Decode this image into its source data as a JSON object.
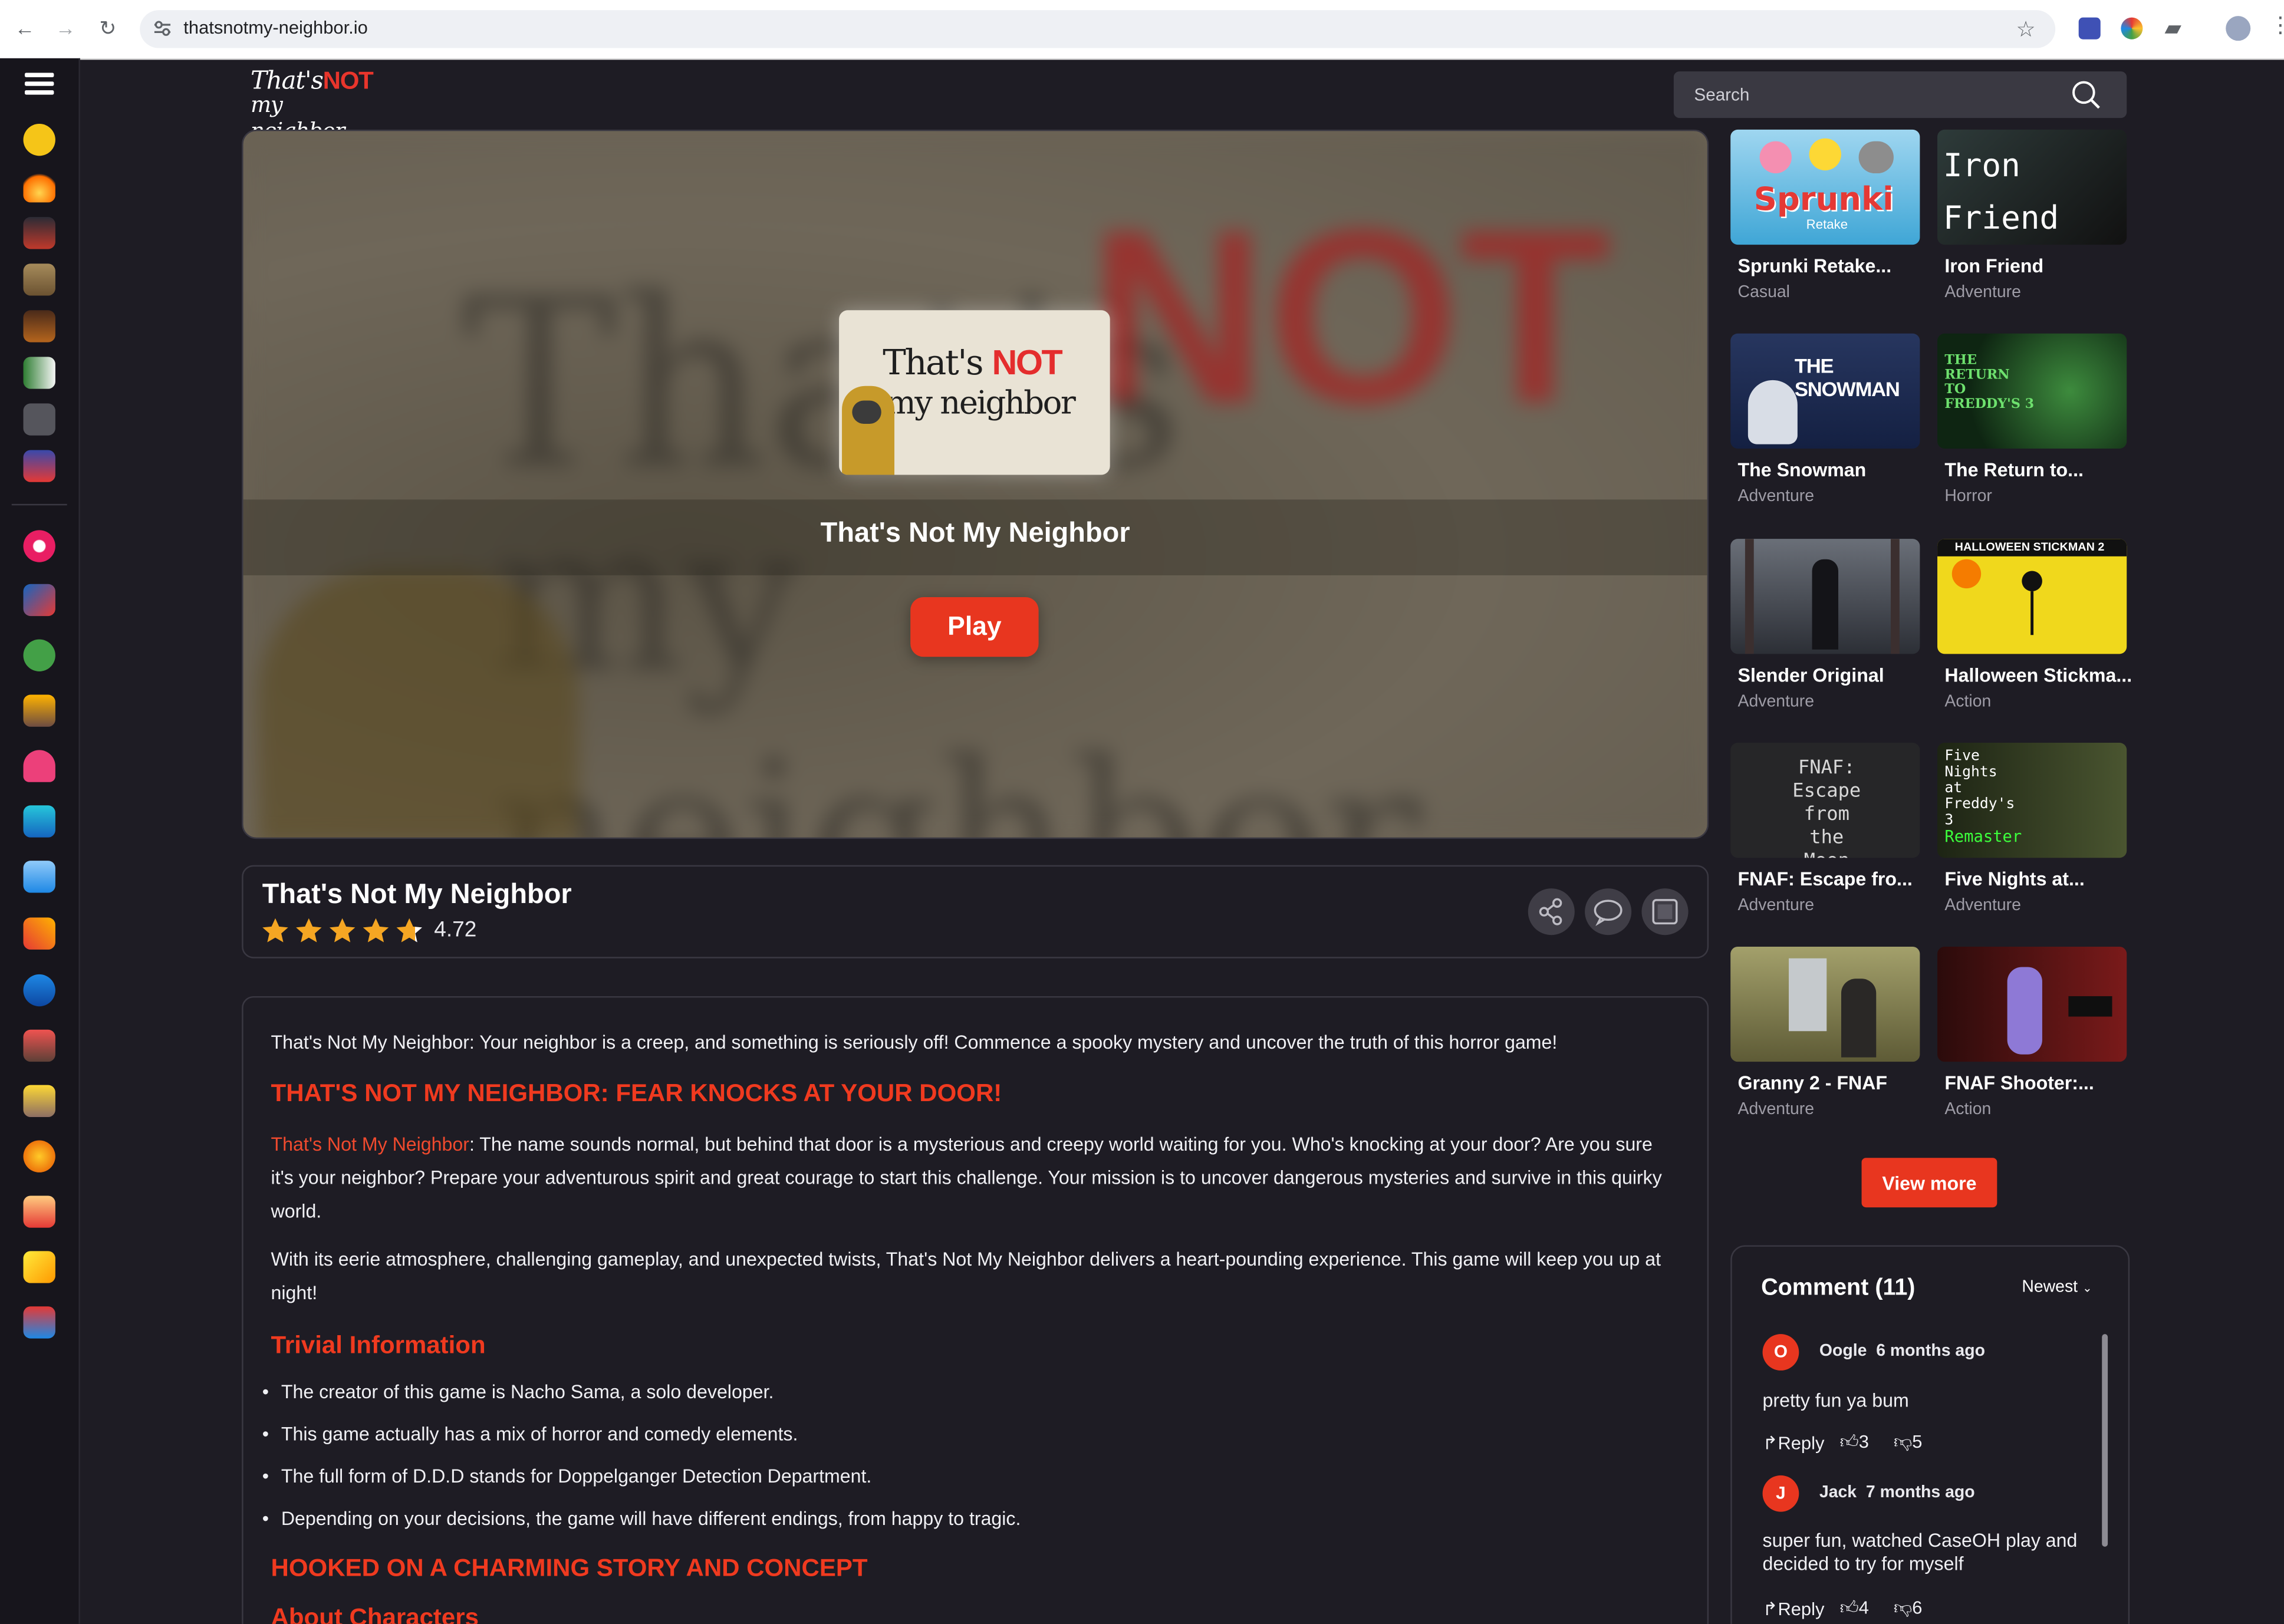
{
  "browser": {
    "url": "thatsnotmy-neighbor.io"
  },
  "site": {
    "logo_line1_a": "That's",
    "logo_line1_b": "NOT",
    "logo_line2": "my neighbor",
    "search_placeholder": "Search"
  },
  "hero": {
    "thumb_line1_a": "That's",
    "thumb_line1_b": "NOT",
    "thumb_line2": "my neighbor",
    "title": "That's Not My Neighbor",
    "play_label": "Play"
  },
  "game": {
    "title": "That's Not My Neighbor",
    "rating": "4.72",
    "stars": 4.72
  },
  "description": {
    "intro": "That's Not My Neighbor: Your neighbor is a creep, and something is seriously off! Commence a spooky mystery and uncover the truth of this horror game!",
    "h1": "THAT'S NOT MY NEIGHBOR: FEAR KNOCKS AT YOUR DOOR!",
    "p1_link": "That's Not My Neighbor",
    "p1_rest": ": The name sounds normal, but behind that door is a mysterious and creepy world waiting for you. Who's knocking at your door? Are you sure it's your neighbor? Prepare your adventurous spirit and great courage to start this challenge. Your mission is to uncover dangerous mysteries and survive in this quirky world.",
    "p2": "With its eerie atmosphere, challenging gameplay, and unexpected twists, That's Not My Neighbor delivers a heart-pounding experience. This game will keep you up at night!",
    "h2": "Trivial Information",
    "bullets": [
      "The creator of this game is Nacho Sama, a solo developer.",
      "This game actually has a mix of horror and comedy elements.",
      "The full form of D.D.D stands for Doppelganger Detection Department.",
      "Depending on your decisions, the game will have different endings, from happy to tragic."
    ],
    "h3": "HOOKED ON A CHARMING STORY AND CONCEPT",
    "h4": "About Characters"
  },
  "related": [
    {
      "name": "Sprunki Retake...",
      "category": "Casual",
      "thumb": "Sprunki",
      "thumb_sub": "Retake",
      "bg": "#3fa6d6"
    },
    {
      "name": "Iron Friend",
      "category": "Adventure",
      "thumb": "Iron Friend",
      "bg": "#1f2a2a"
    },
    {
      "name": "The Snowman",
      "category": "Adventure",
      "thumb": "THE SNOWMAN",
      "bg": "#1e2f57"
    },
    {
      "name": "The Return to...",
      "category": "Horror",
      "thumb": "THE RETURN TO FREDDY'S 3",
      "bg": "#163a1c"
    },
    {
      "name": "Slender Original",
      "category": "Adventure",
      "thumb": "",
      "bg": "#3a4048"
    },
    {
      "name": "Halloween Stickma...",
      "category": "Action",
      "thumb": "HALLOWEEN STICKMAN 2",
      "bg": "#f0d81c"
    },
    {
      "name": "FNAF: Escape fro...",
      "category": "Adventure",
      "thumb": "FNAF: Escape from the Moon",
      "bg": "#2a2a2c"
    },
    {
      "name": "Five Nights at...",
      "category": "Adventure",
      "thumb": "Five Nights at Freddy's 3",
      "thumb_sub": "Remaster",
      "bg": "#2d3420"
    },
    {
      "name": "Granny 2 - FNAF",
      "category": "Adventure",
      "thumb": "",
      "bg": "#8e8a58"
    },
    {
      "name": "FNAF Shooter:...",
      "category": "Action",
      "thumb": "",
      "bg": "#4a1212"
    }
  ],
  "view_more_label": "View more",
  "comments": {
    "title": "Comment (11)",
    "sort_label": "Newest",
    "items": [
      {
        "initial": "O",
        "author": "Oogle",
        "time": "6 months ago",
        "text": "pretty fun ya bum",
        "reply": "Reply",
        "likes": "3",
        "dislikes": "5"
      },
      {
        "initial": "J",
        "author": "Jack",
        "time": "7 months ago",
        "text": "super fun, watched CaseOH play and decided to try for myself",
        "reply": "Reply",
        "likes": "4",
        "dislikes": "6"
      }
    ]
  },
  "colors": {
    "accent": "#e8361f",
    "background": "#1e1c24",
    "rail": "#17151c"
  },
  "rail_icons": [
    "new-badge-icon",
    "fire-icon",
    "game-1-icon",
    "game-2-icon",
    "game-3-icon",
    "game-4-icon",
    "game-5-icon",
    "game-6-icon",
    "horror-icon",
    "action-icon",
    "zombie-icon",
    "house-icon",
    "monster-icon",
    "arcade-icon",
    "computer-icon",
    "crossed-swords-icon",
    "plane-icon",
    "robot-icon",
    "sign-icon",
    "racing-icon",
    "multiplayer-icon",
    "rocket-icon",
    "sports-icon"
  ]
}
